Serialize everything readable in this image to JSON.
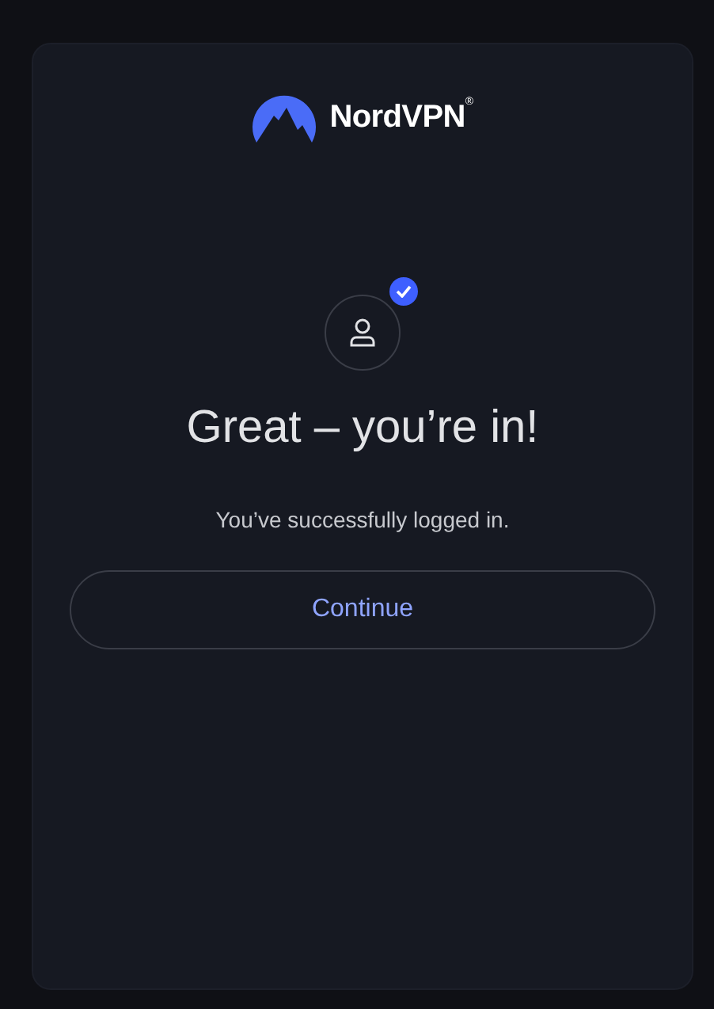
{
  "logo": {
    "text": "NordVPN$^{®}$"
  },
  "status": {
    "verified": true
  },
  "title": "Great – you’re in!",
  "message": "You’ve successfully logged in.",
  "button": {
    "label": "Continue"
  }
}
